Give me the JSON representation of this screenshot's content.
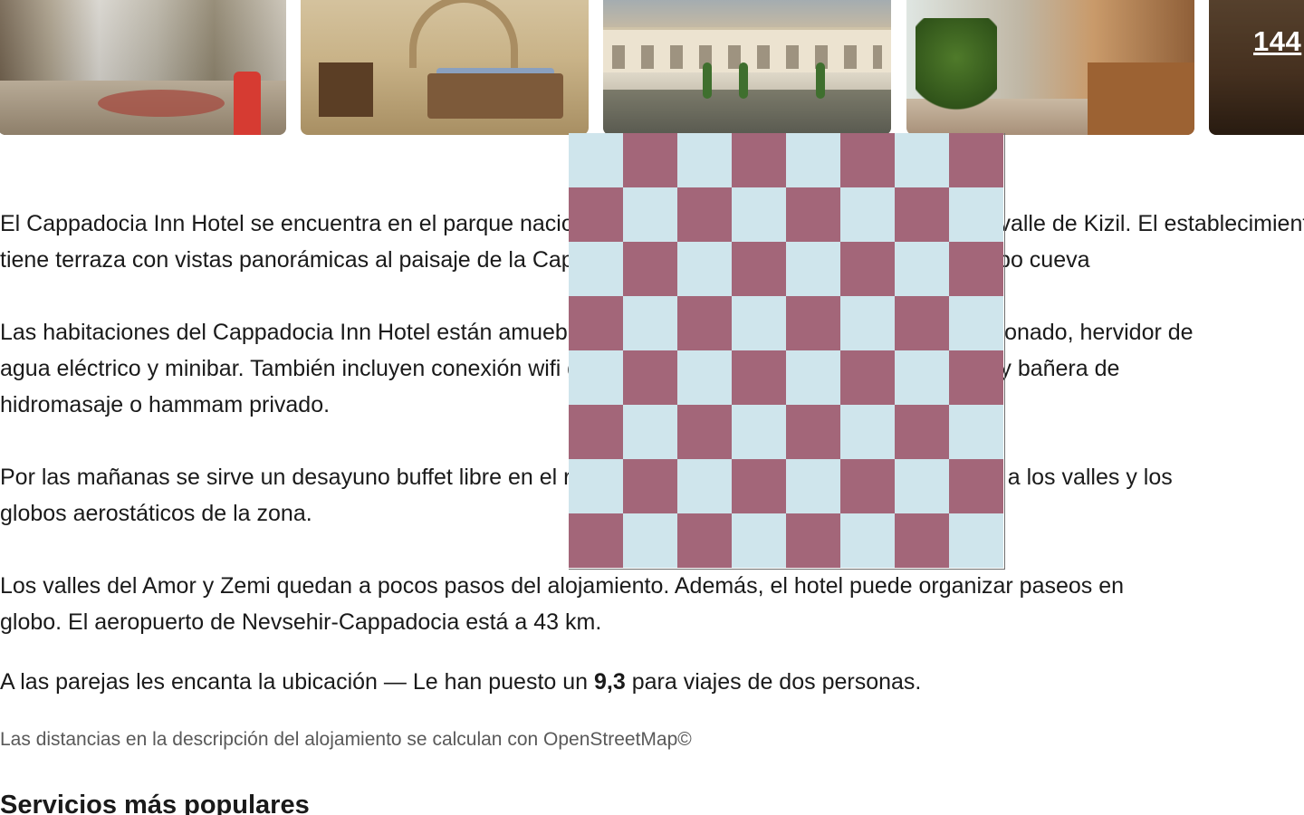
{
  "photos": {
    "items": [
      {
        "name": "lobby-photo"
      },
      {
        "name": "room-photo"
      },
      {
        "name": "courtyard-photo"
      },
      {
        "name": "restaurant-photo"
      },
      {
        "name": "more-photo"
      }
    ],
    "more_count": "144"
  },
  "description": {
    "p1_line1": "El Cappadocia Inn Hotel se encuentra en el parque nacional de Göreme, a pocos minutos a pie del valle de Kizil. El establecimiento",
    "p1_line2": "tiene terraza con vistas panorámicas al paisaje de la Capadocia y ofrece habitaciones de piedra o tipo cueva",
    "p2_line1": "Las habitaciones del Cappadocia Inn Hotel están amuebladas con estilo y disponen de aire acondicionado, hervidor de",
    "p2_line2": "agua eléctrico y minibar. También incluyen conexión wifi gratuita. En algunas de las habitaciones hay bañera de",
    "p2_line3": "hidromasaje o hammam privado.",
    "p3_line1": "Por las mañanas se sirve un desayuno buffet libre en el restaurante del hotel, que cuenta con vistas a los valles y los",
    "p3_line2": "globos aerostáticos de la zona.",
    "p4_line1": "Los valles del Amor y Zemi quedan a pocos pasos del alojamiento. Además, el hotel puede organizar paseos en",
    "p4_line2": "globo. El aeropuerto de Nevsehir-Cappadocia está a 43 km."
  },
  "rating": {
    "prefix": "A las parejas les encanta la ubicación — Le han puesto un ",
    "score": "9,3",
    "suffix": " para viajes de dos personas."
  },
  "distance_note": "Las distancias en la descripción del alojamiento se calculan con OpenStreetMap©",
  "section_title": "Servicios más populares",
  "overlay": {
    "color_a": "#cfe5ec",
    "color_b": "#a36679"
  }
}
